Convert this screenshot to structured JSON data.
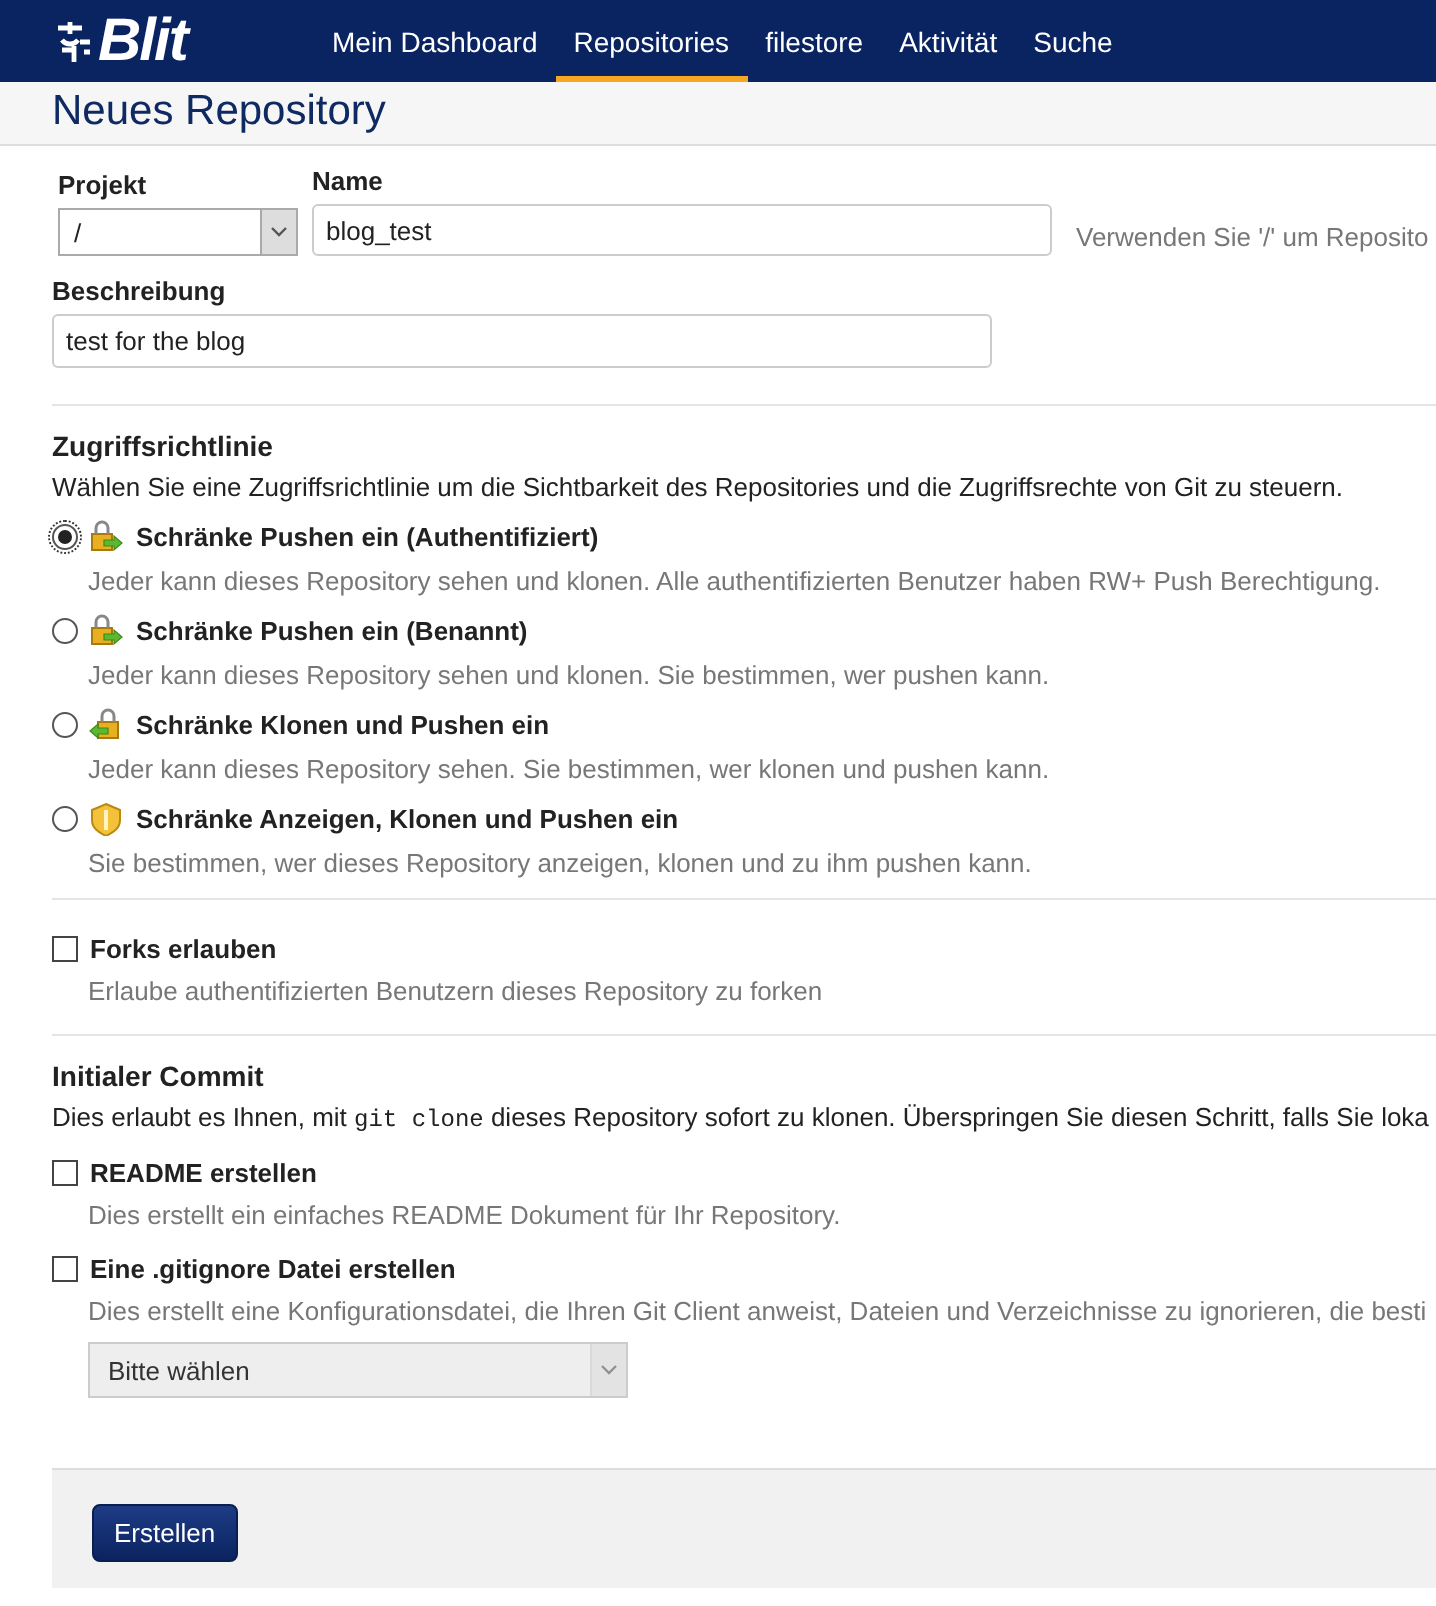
{
  "nav": {
    "logo": "Blit",
    "items": [
      {
        "label": "Mein Dashboard",
        "selected": false
      },
      {
        "label": "Repositories",
        "selected": true
      },
      {
        "label": "filestore",
        "selected": false
      },
      {
        "label": "Aktivität",
        "selected": false
      },
      {
        "label": "Suche",
        "selected": false
      }
    ]
  },
  "page_title": "Neues Repository",
  "form": {
    "project": {
      "label": "Projekt",
      "value": "/"
    },
    "name": {
      "label": "Name",
      "value": "blog_test",
      "hint": "Verwenden Sie '/' um Reposito"
    },
    "description": {
      "label": "Beschreibung",
      "value": "test for the blog"
    }
  },
  "access": {
    "title": "Zugriffsrichtlinie",
    "text": "Wählen Sie eine Zugriffsrichtlinie um die Sichtbarkeit des Repositories und die Zugriffsrechte von Git zu steuern.",
    "options": [
      {
        "kind": "push",
        "label": "Schränke Pushen ein (Authentifiziert)",
        "description": "Jeder kann dieses Repository sehen und klonen. Alle authentifizierten Benutzer haben RW+ Push Berechtigung.",
        "selected": true
      },
      {
        "kind": "push",
        "label": "Schränke Pushen ein (Benannt)",
        "description": "Jeder kann dieses Repository sehen und klonen. Sie bestimmen, wer pushen kann.",
        "selected": false
      },
      {
        "kind": "clone",
        "label": "Schränke Klonen und Pushen ein",
        "description": "Jeder kann dieses Repository sehen. Sie bestimmen, wer klonen und pushen kann.",
        "selected": false
      },
      {
        "kind": "view",
        "label": "Schränke Anzeigen, Klonen und Pushen ein",
        "description": "Sie bestimmen, wer dieses Repository anzeigen, klonen und zu ihm pushen kann.",
        "selected": false
      }
    ]
  },
  "forks": {
    "label": "Forks erlauben",
    "description": "Erlaube authentifizierten Benutzern dieses Repository zu forken",
    "checked": false
  },
  "initial_commit": {
    "title": "Initialer Commit",
    "text_before": "Dies erlaubt es Ihnen, mit ",
    "code": "git clone",
    "text_after": " dieses Repository sofort zu klonen. Überspringen Sie diesen Schritt, falls Sie loka",
    "options": [
      {
        "label": "README erstellen",
        "description": "Dies erstellt ein einfaches README Dokument für Ihr Repository.",
        "checked": false
      },
      {
        "label": "Eine .gitignore Datei erstellen",
        "description": "Dies erstellt eine Konfigurationsdatei, die Ihren Git Client anweist, Dateien und Verzeichnisse zu ignorieren, die besti",
        "checked": false
      }
    ],
    "gitignore_select": {
      "value": "Bitte wählen",
      "disabled": true
    }
  },
  "submit": "Erstellen"
}
